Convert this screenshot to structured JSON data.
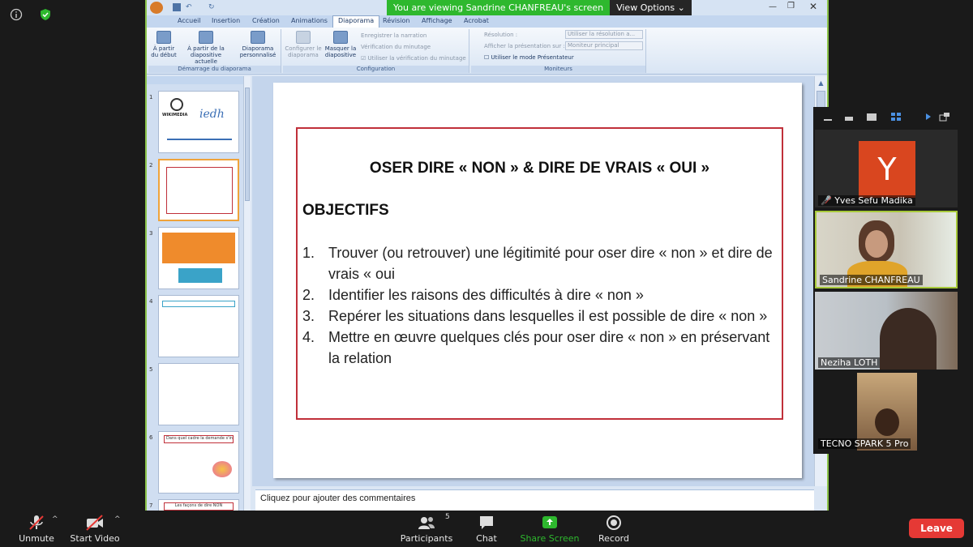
{
  "zoom": {
    "share_banner": "You are viewing Sandrine CHANFREAU's screen",
    "view_options": "View Options",
    "toolbar": {
      "unmute": "Unmute",
      "start_video": "Start Video",
      "participants": "Participants",
      "participant_count": "5",
      "chat": "Chat",
      "share_screen": "Share Screen",
      "record": "Record",
      "leave": "Leave"
    },
    "participants": [
      {
        "name": "Yves Sefu Madika",
        "initial": "Y",
        "muted": true
      },
      {
        "name": "Sandrine CHANFREAU",
        "active": true
      },
      {
        "name": "Neziha LOTH"
      },
      {
        "name": "TECNO SPARK 5 Pro"
      }
    ],
    "colors": {
      "accent_green": "#2eb82e",
      "leave_red": "#e53935",
      "avatar_red": "#d9461f"
    }
  },
  "ppt": {
    "tabs": [
      "Accueil",
      "Insertion",
      "Création",
      "Animations",
      "Diaporama",
      "Révision",
      "Affichage",
      "Acrobat"
    ],
    "active_tab": "Diaporama",
    "ribbon": {
      "start_group": {
        "label": "Démarrage du diaporama",
        "from_start": "À partir du début",
        "from_current": "À partir de la diapositive actuelle",
        "custom": "Diaporama personnalisé"
      },
      "config_group": {
        "label": "Configuration",
        "configure": "Configurer le diaporama",
        "hide": "Masquer la diapositive",
        "record_narration": "Enregistrer la narration",
        "rehearse": "Vérification du minutage",
        "use_timings": "Utiliser la vérification du minutage"
      },
      "monitor_group": {
        "label": "Moniteurs",
        "resolution_label": "Résolution :",
        "resolution_value": "Utiliser la résolution a...",
        "show_on_label": "Afficher la présentation sur :",
        "show_on_value": "Moniteur principal",
        "presenter_mode": "Utiliser le mode Présentateur"
      }
    },
    "thumbnails": [
      "1",
      "2",
      "3",
      "4",
      "5",
      "6",
      "7"
    ],
    "thumb_text": {
      "t1_brand": "WIKIMEDIA",
      "t1_logo": "iedh",
      "t6_title": "Dans quel cadre la demande s'inscrit",
      "t7_title": "Les façons de dire NON"
    },
    "slide": {
      "title": "OSER DIRE « NON » & DIRE DE VRAIS « OUI »",
      "objectives_heading": "OBJECTIFS",
      "objectives": [
        {
          "num": "1.",
          "text": "Trouver (ou retrouver) une légitimité pour oser dire « non » et dire de vrais « oui"
        },
        {
          "num": "2.",
          "text": "Identifier les raisons des difficultés à dire « non »"
        },
        {
          "num": "3.",
          "text": "Repérer les situations dans lesquelles il est possible de dire « non »"
        },
        {
          "num": "4.",
          "text": "Mettre en œuvre quelques clés pour oser dire « non » en préservant la relation"
        }
      ]
    },
    "notes_placeholder": "Cliquez pour ajouter des commentaires"
  }
}
